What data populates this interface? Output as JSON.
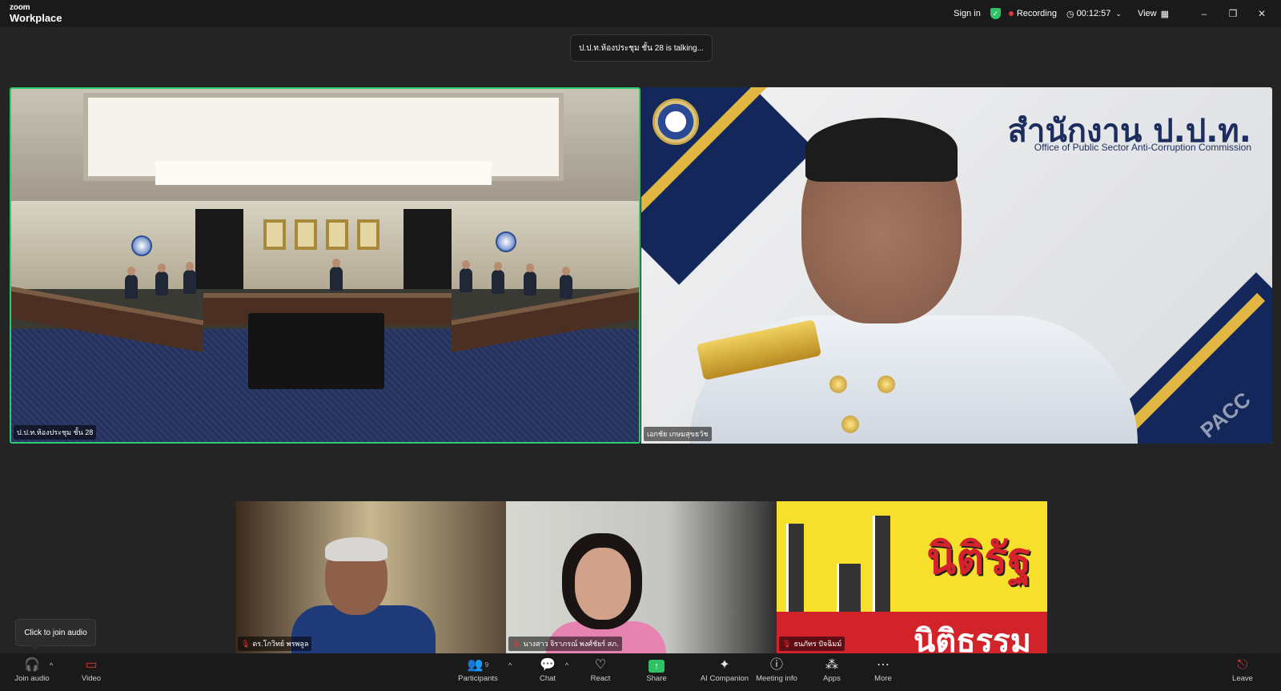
{
  "app": {
    "logo_top": "zoom",
    "logo_bottom": "Workplace"
  },
  "titlebar": {
    "sign_in": "Sign in",
    "recording": "Recording",
    "timer": "00:12:57",
    "view": "View",
    "shield_color": "#2fc267",
    "record_color": "#e5323b"
  },
  "talking_banner": "ป.ป.ท.ห้องประชุม ชั้น 28 is talking...",
  "main_tiles": [
    {
      "label": "ป.ป.ท.ห้องประชุม ชั้น 28",
      "active_speaker": true,
      "border_color": "#2ecc71"
    },
    {
      "label": "เอกชัย เกษมสุขธวัช"
    }
  ],
  "pacc_slide": {
    "title": "สำนักงาน ป.ป.ท.",
    "subtitle": "Office of Public Sector Anti-Corruption Commission",
    "watermark": "PACC"
  },
  "strip_tiles": [
    {
      "label": "ดร.โกวิทย์ พรพลูล"
    },
    {
      "label": "นางสาว จิราภรณ์ พงศ์ชัยร์ สภ."
    },
    {
      "label": "ธนภัทร ปัจฉิมม์"
    }
  ],
  "niti_poster": {
    "line1": "นิติรัฐ",
    "line2": "นิติธรรม"
  },
  "tooltip": "Click to join audio",
  "toolbar": {
    "join_audio": "Join audio",
    "video": "Video",
    "participants": "Participants",
    "participants_count": "9",
    "chat": "Chat",
    "react": "React",
    "share": "Share",
    "ai_companion": "AI Companion",
    "meeting_info": "Meeting info",
    "apps": "Apps",
    "more": "More",
    "leave": "Leave"
  }
}
